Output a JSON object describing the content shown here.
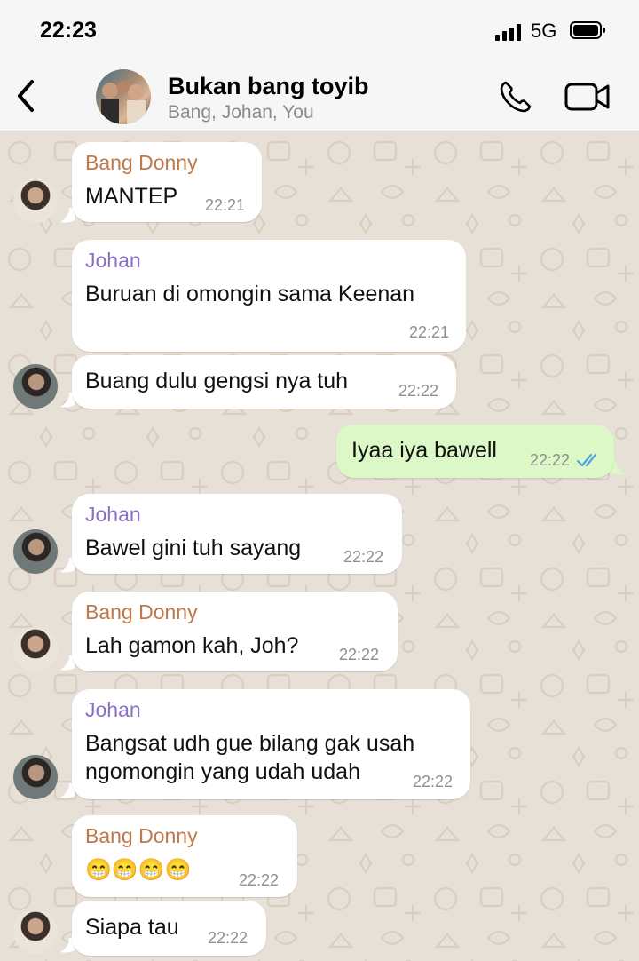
{
  "status": {
    "time": "22:23",
    "network": "5G"
  },
  "header": {
    "title": "Bukan bang toyib",
    "members": "Bang, Johan, You"
  },
  "colors": {
    "sender_donny": "#c0784a",
    "sender_johan": "#8a6fc4",
    "outgoing": "#dcf8c6",
    "read_ticks": "#4fa3e0"
  },
  "messages": [
    {
      "sender": "Bang Donny",
      "text": "MANTEP",
      "time": "22:21"
    },
    {
      "sender": "Johan",
      "text": "Buruan di omongin sama Keenan",
      "time": "22:21"
    },
    {
      "text": "Buang dulu gengsi nya tuh",
      "time": "22:22"
    },
    {
      "text": "Iyaa iya bawell",
      "time": "22:22",
      "status": "read"
    },
    {
      "sender": "Johan",
      "text": "Bawel gini tuh sayang",
      "time": "22:22"
    },
    {
      "sender": "Bang Donny",
      "text": "Lah gamon kah, Joh?",
      "time": "22:22"
    },
    {
      "sender": "Johan",
      "text_line1": "Bangsat udh gue bilang gak usah",
      "text_line2": "ngomongin yang udah udah",
      "time": "22:22"
    },
    {
      "sender": "Bang Donny",
      "text": "😁😁😁😁",
      "time": "22:22"
    },
    {
      "text": "Siapa tau",
      "time": "22:22"
    }
  ]
}
